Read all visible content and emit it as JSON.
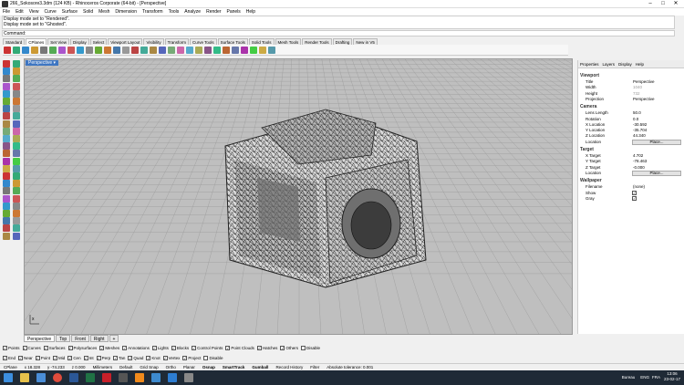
{
  "titlebar": {
    "title": "266_Sokosore3.3dm (124 KB) - Rhinoceros Corporate (64-bit) - [Perspective]",
    "minimize": "–",
    "maximize": "□",
    "close": "✕"
  },
  "menu": [
    "File",
    "Edit",
    "View",
    "Curve",
    "Surface",
    "Solid",
    "Mesh",
    "Dimension",
    "Transform",
    "Tools",
    "Analyze",
    "Render",
    "Panels",
    "Help"
  ],
  "command_history": [
    "Display mode set to \"Rendered\".",
    "Display mode set to \"Ghosted\"."
  ],
  "command_prompt": "Command:",
  "toolbar_tabs": [
    "Standard",
    "CPlanes",
    "Set View",
    "Display",
    "Select",
    "Viewport Layout",
    "Visibility",
    "Transform",
    "Curve Tools",
    "Surface Tools",
    "Solid Tools",
    "Mesh Tools",
    "Render Tools",
    "Drafting",
    "New in V5"
  ],
  "active_toolbar_tab": "CPlanes",
  "viewport": {
    "label": "Perspective ▾",
    "axis_label": "x"
  },
  "viewport_tabs": [
    "Perspective",
    "Top",
    "Front",
    "Right",
    "+"
  ],
  "panel": {
    "tabs": [
      "Properties",
      "Layers",
      "Display",
      "Help"
    ],
    "sections": {
      "viewport": "Viewport",
      "camera": "Camera",
      "target": "Target",
      "wallpaper": "Wallpaper"
    },
    "viewport_rows": [
      {
        "k": "Title",
        "v": "Perspective"
      },
      {
        "k": "Width",
        "v": "1040"
      },
      {
        "k": "Height",
        "v": "732"
      },
      {
        "k": "Projection",
        "v": "Perspective"
      }
    ],
    "camera_rows": [
      {
        "k": "Lens Length",
        "v": "50.0"
      },
      {
        "k": "Rotation",
        "v": "0.0"
      },
      {
        "k": "X Location",
        "v": "-30.592"
      },
      {
        "k": "Y Location",
        "v": "-35.704"
      },
      {
        "k": "Z Location",
        "v": "44.340"
      },
      {
        "k": "Location",
        "v": "Place..."
      }
    ],
    "target_rows": [
      {
        "k": "X Target",
        "v": "4.702"
      },
      {
        "k": "Y Target",
        "v": "-78.463"
      },
      {
        "k": "Z Target",
        "v": "-0.000"
      },
      {
        "k": "Location",
        "v": "Place..."
      }
    ],
    "wallpaper_rows": [
      {
        "k": "Filename",
        "v": "(none)"
      },
      {
        "k": "Show",
        "v": "✓"
      },
      {
        "k": "Gray",
        "v": "✓"
      }
    ]
  },
  "osnaps_row1": [
    "Points",
    "Curves",
    "Surfaces",
    "Polysurfaces",
    "Meshes",
    "Annotations",
    "Lights",
    "Blocks",
    "Control Points",
    "Point Clouds",
    "Hatches",
    "Others",
    "Disable"
  ],
  "osnaps_row2": [
    "End",
    "Near",
    "Point",
    "Mid",
    "Cen",
    "Int",
    "Perp",
    "Tan",
    "Quad",
    "Knot",
    "Vertex",
    "Project",
    "Disable"
  ],
  "status": {
    "cplane": "CPlane",
    "x": "x 18.328",
    "y": "y -74.233",
    "z": "z 0.000",
    "units": "Millimeters",
    "layer": "Default",
    "items": [
      "Grid Snap",
      "Ortho",
      "Planar",
      "Osnap",
      "SmartTrack",
      "Gumball",
      "Record History",
      "Filter"
    ],
    "tolerance": "Absolute tolerance: 0.001"
  },
  "tray": {
    "lang": "ENG",
    "region": "FRA",
    "time": "13:06",
    "date": "23-02-17",
    "user": "Bureau"
  },
  "colors": {
    "viewport_bg": "#bfbfbf",
    "grid": "#9a9a9a",
    "mesh": "#2a2a2a",
    "taskbar": "#1f2a36",
    "vp_label": "#3e76c2"
  }
}
